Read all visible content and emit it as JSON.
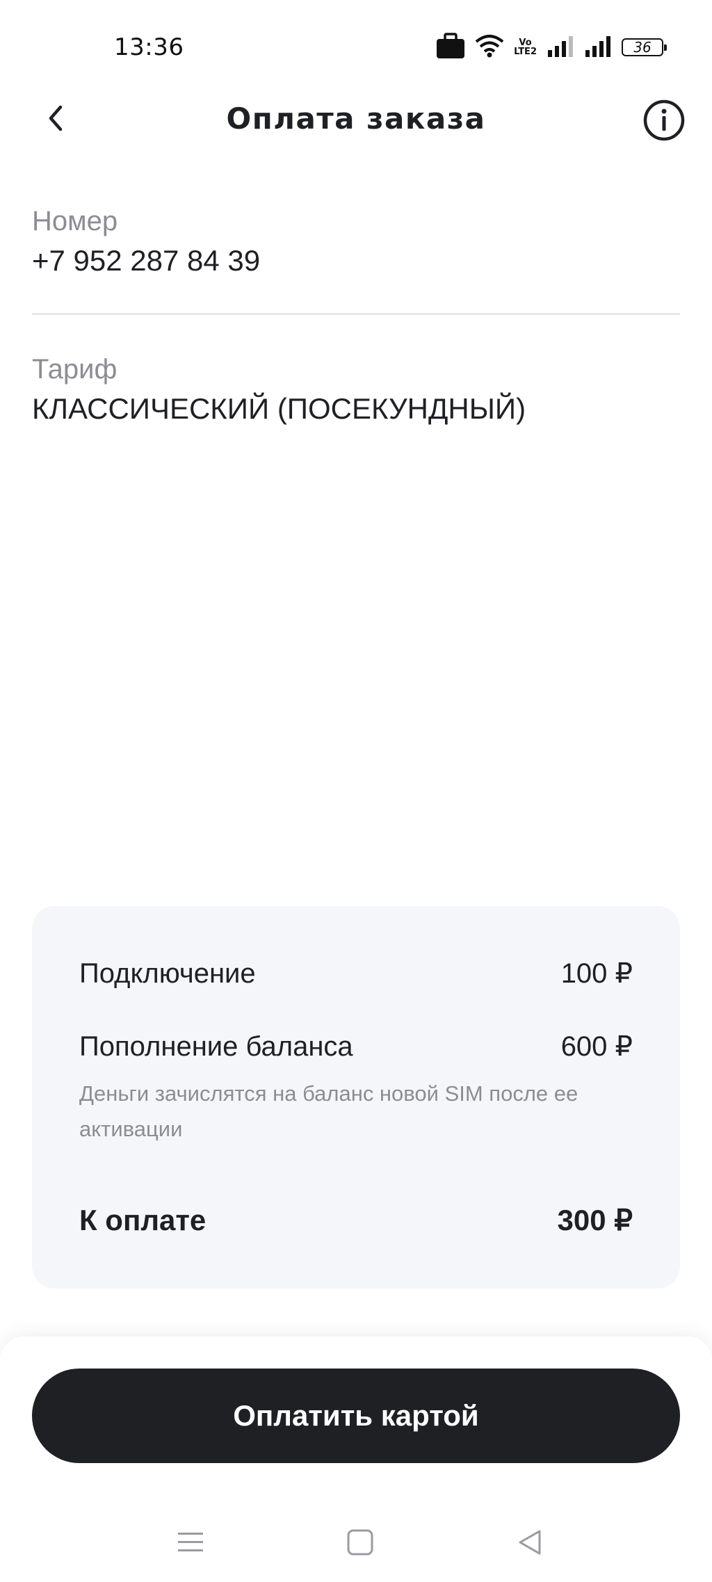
{
  "status_bar": {
    "time": "13:36",
    "volte_top": "Vo",
    "volte_bottom": "LTE2",
    "battery": "36"
  },
  "header": {
    "title": "Оплата заказа"
  },
  "fields": {
    "number": {
      "label": "Номер",
      "value": "+7 952 287 84 39"
    },
    "tariff": {
      "label": "Тариф",
      "value": "КЛАССИЧЕСКИЙ (ПОСЕКУНДНЫЙ)"
    }
  },
  "summary": {
    "connection": {
      "label": "Подключение",
      "amount": "100 ₽"
    },
    "topup": {
      "label": "Пополнение баланса",
      "amount": "600 ₽",
      "note": "Деньги зачислятся на баланс новой SIM после ее активации"
    },
    "total": {
      "label": "К оплате",
      "amount": "300 ₽"
    }
  },
  "actions": {
    "pay_label": "Оплатить картой"
  },
  "colors": {
    "primary_dark": "#1f2024",
    "muted_text": "#8c8d93",
    "card_bg": "#f5f6fa",
    "divider": "#e6e7ea"
  },
  "icons": {
    "back": "chevron-left-icon",
    "info": "info-circle-icon",
    "nav_menu": "menu-icon",
    "nav_home": "square-icon",
    "nav_back": "triangle-back-icon"
  }
}
